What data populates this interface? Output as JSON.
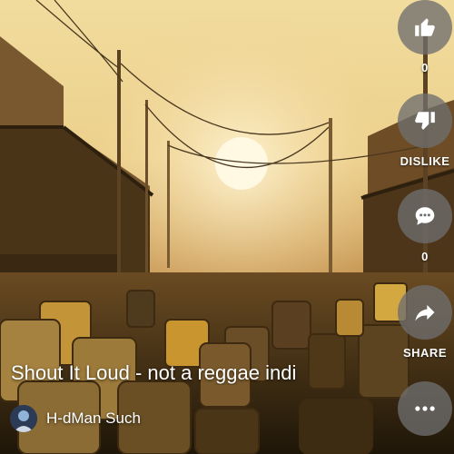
{
  "video": {
    "title": "Shout It Loud - not a reggae indi",
    "channel_name": "H-dMan Such",
    "thumbnail_icon": "foggy-sunset-alley-barrels-image"
  },
  "actions": {
    "like": {
      "icon": "thumbs-up-icon",
      "count": "0"
    },
    "dislike": {
      "icon": "thumbs-down-icon",
      "label": "DISLIKE"
    },
    "comments": {
      "icon": "comment-icon",
      "count": "0"
    },
    "share": {
      "icon": "share-arrow-icon",
      "label": "SHARE"
    },
    "more": {
      "icon": "more-horizontal-icon"
    }
  },
  "colors": {
    "button_bg": "#6e6e6e",
    "text": "#ffffff",
    "sky": "#e8c98a"
  }
}
